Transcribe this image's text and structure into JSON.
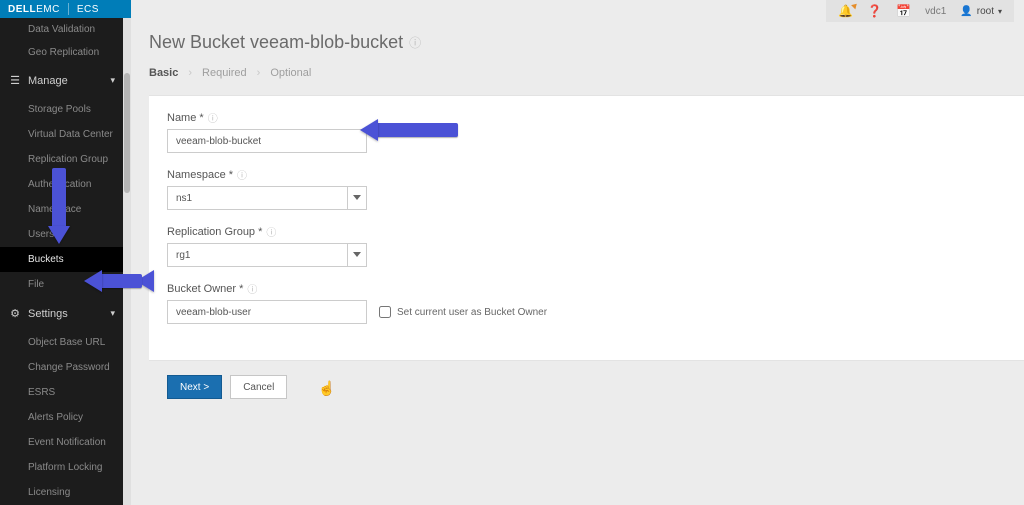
{
  "brand": {
    "dell": "DELL",
    "emc": "EMC",
    "product": "ECS"
  },
  "topbar": {
    "vdc": "vdc1",
    "user": "root"
  },
  "sidebar": {
    "topItems": [
      {
        "label": "Data Validation"
      },
      {
        "label": "Geo Replication"
      }
    ],
    "manage": {
      "header": "Manage",
      "items": [
        {
          "label": "Storage Pools"
        },
        {
          "label": "Virtual Data Center"
        },
        {
          "label": "Replication Group"
        },
        {
          "label": "Authentication"
        },
        {
          "label": "Namespace"
        },
        {
          "label": "Users"
        },
        {
          "label": "Buckets",
          "active": true
        },
        {
          "label": "File"
        }
      ]
    },
    "settings": {
      "header": "Settings",
      "items": [
        {
          "label": "Object Base URL"
        },
        {
          "label": "Change Password"
        },
        {
          "label": "ESRS"
        },
        {
          "label": "Alerts Policy"
        },
        {
          "label": "Event Notification"
        },
        {
          "label": "Platform Locking"
        },
        {
          "label": "Licensing"
        }
      ]
    }
  },
  "page": {
    "title": "New Bucket veeam-blob-bucket",
    "wizard": {
      "step1": "Basic",
      "step2": "Required",
      "step3": "Optional"
    },
    "form": {
      "name_label": "Name *",
      "name_value": "veeam-blob-bucket",
      "namespace_label": "Namespace *",
      "namespace_value": "ns1",
      "rg_label": "Replication Group *",
      "rg_value": "rg1",
      "owner_label": "Bucket Owner *",
      "owner_value": "veeam-blob-user",
      "owner_checkbox_label": "Set current user as Bucket Owner"
    },
    "actions": {
      "next": "Next >",
      "cancel": "Cancel"
    }
  }
}
